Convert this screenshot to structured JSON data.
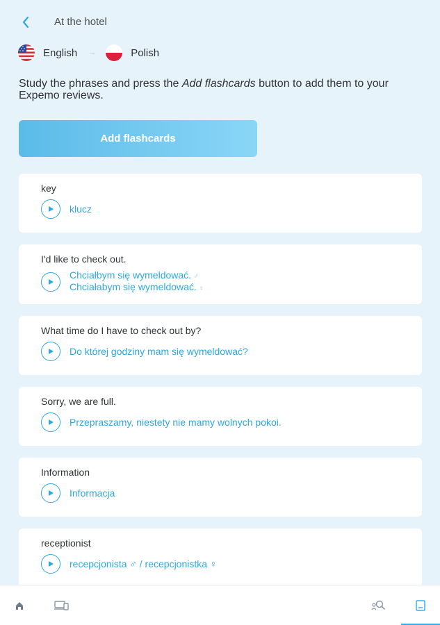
{
  "header": {
    "title": "At the hotel",
    "back_icon": "chevron-left-icon"
  },
  "languages": {
    "source": {
      "label": "English",
      "flag": "us-flag-icon"
    },
    "target": {
      "label": "Polish",
      "flag": "poland-flag-icon"
    },
    "arrow": "→"
  },
  "intro": {
    "before": "Study the phrases and press the ",
    "emphasis": "Add flashcards",
    "after": " button to add them to your Expemo reviews."
  },
  "add_button": {
    "label": "Add flashcards"
  },
  "phrases": [
    {
      "english": "key",
      "polish": [
        {
          "text": "klucz",
          "gender": ""
        }
      ]
    },
    {
      "english": "I'd like to check out.",
      "polish": [
        {
          "text": "Chciałbym się wymeldować.",
          "gender": "♂"
        },
        {
          "text": "Chciałabym się wymeldować.",
          "gender": "♀"
        }
      ]
    },
    {
      "english": "What time do I have to check out by?",
      "polish": [
        {
          "text": "Do której godziny mam się wymeldować?",
          "gender": ""
        }
      ]
    },
    {
      "english": "Sorry, we are full.",
      "polish": [
        {
          "text": "Przepraszamy, niestety nie mamy wolnych pokoi.",
          "gender": ""
        }
      ]
    },
    {
      "english": "Information",
      "polish": [
        {
          "text": "Informacja",
          "gender": ""
        }
      ]
    },
    {
      "english": "receptionist",
      "polish": [
        {
          "text": "recepcjonista ♂ / recepcjonistka ♀",
          "gender": ""
        }
      ]
    }
  ],
  "bottom_nav": {
    "items": [
      {
        "icon": "home-icon"
      },
      {
        "icon": "devices-icon"
      },
      {
        "icon": "search-people-icon"
      },
      {
        "icon": "flashcards-icon",
        "active": true
      }
    ],
    "accent": "#3aaee0"
  },
  "colors": {
    "background": "#e6f3fb",
    "accent": "#2fa7dc",
    "button_start": "#5bbbe8",
    "button_end": "#8ad6f7"
  }
}
